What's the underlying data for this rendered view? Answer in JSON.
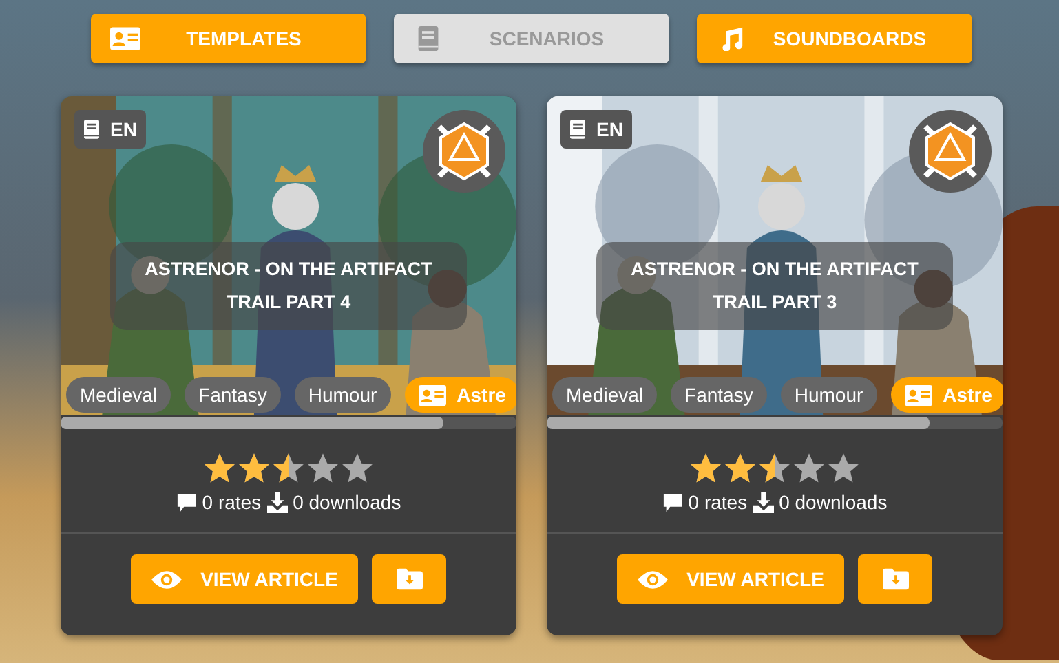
{
  "nav": [
    {
      "label": "TEMPLATES",
      "kind": "card",
      "selected": false
    },
    {
      "label": "SCENARIOS",
      "kind": "book",
      "selected": true
    },
    {
      "label": "SOUNDBOARDS",
      "kind": "music",
      "selected": false
    }
  ],
  "cards": [
    {
      "language": "EN",
      "title": "ASTRENOR - ON THE ARTIFACT TRAIL PART 4",
      "tags": [
        {
          "label": "Medieval",
          "kind": "genre"
        },
        {
          "label": "Fantasy",
          "kind": "genre"
        },
        {
          "label": "Humour",
          "kind": "genre"
        },
        {
          "label": "Astre",
          "kind": "template"
        }
      ],
      "stars": 2.5,
      "rates": "0 rates",
      "downloads": "0 downloads",
      "action": "VIEW ARTICLE"
    },
    {
      "language": "EN",
      "title": "ASTRENOR - ON THE ARTIFACT TRAIL PART 3",
      "tags": [
        {
          "label": "Medieval",
          "kind": "genre"
        },
        {
          "label": "Fantasy",
          "kind": "genre"
        },
        {
          "label": "Humour",
          "kind": "genre"
        },
        {
          "label": "Astre",
          "kind": "template"
        }
      ],
      "stars": 2.5,
      "rates": "0 rates",
      "downloads": "0 downloads",
      "action": "VIEW ARTICLE"
    }
  ]
}
